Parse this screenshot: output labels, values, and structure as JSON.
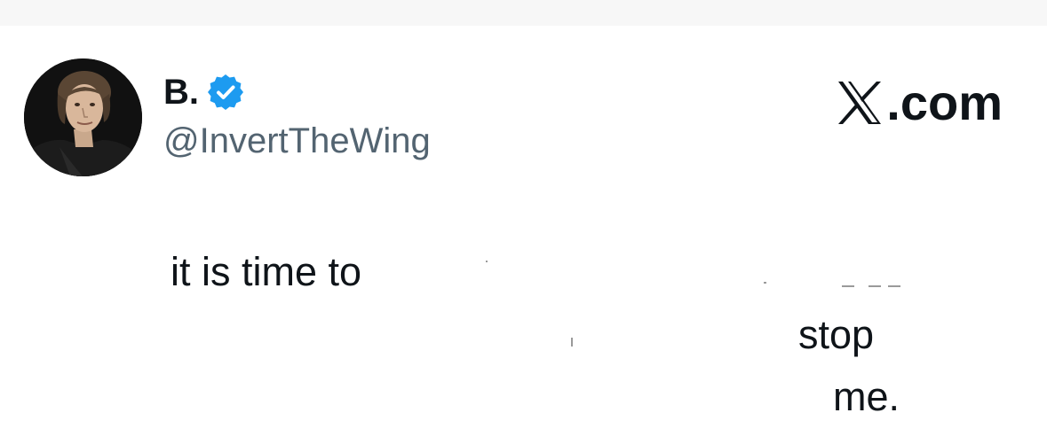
{
  "header": {
    "display_name": "B.",
    "handle": "@InvertTheWing",
    "verified_icon": "verified-badge-icon",
    "brand_text": ".com",
    "brand_logo": "x-logo-icon",
    "avatar": "profile-photo"
  },
  "tweet": {
    "line_1": "it is time to",
    "line_2": "stop",
    "line_3": "me."
  },
  "colors": {
    "text_primary": "#0f1419",
    "text_secondary": "#536471",
    "verified_blue": "#1d9bf0",
    "top_strip": "#f7f7f7"
  }
}
